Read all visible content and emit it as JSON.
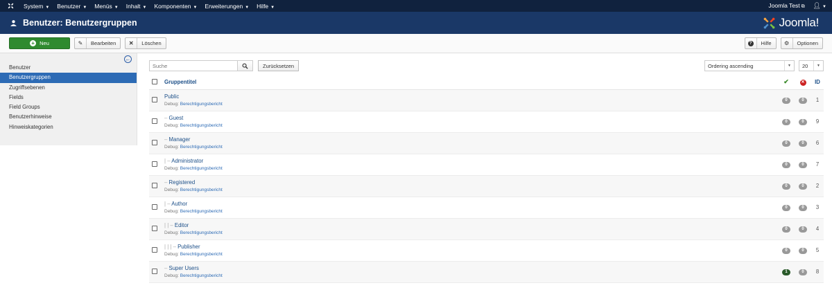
{
  "navbar": {
    "menu": [
      "System",
      "Benutzer",
      "Menüs",
      "Inhalt",
      "Komponenten",
      "Erweiterungen",
      "Hilfe"
    ],
    "site_link": "Joomla Test"
  },
  "header": {
    "title": "Benutzer: Benutzergruppen",
    "brand": "Joomla!"
  },
  "toolbar": {
    "new_label": "Neu",
    "edit_label": "Bearbeiten",
    "delete_label": "Löschen",
    "help_label": "Hilfe",
    "options_label": "Optionen"
  },
  "sidebar": {
    "items": [
      {
        "label": "Benutzer",
        "active": false
      },
      {
        "label": "Benutzergruppen",
        "active": true
      },
      {
        "label": "Zugriffsebenen",
        "active": false
      },
      {
        "label": "Fields",
        "active": false
      },
      {
        "label": "Field Groups",
        "active": false
      },
      {
        "label": "Benutzerhinweise",
        "active": false
      },
      {
        "label": "Hinweiskategorien",
        "active": false
      }
    ]
  },
  "filters": {
    "search_placeholder": "Suche",
    "reset_label": "Zurücksetzen",
    "ordering": "Ordering ascending",
    "limit": "20"
  },
  "table": {
    "header_title": "Gruppentitel",
    "header_id": "ID",
    "debug_prefix": "Debug:",
    "debug_link": "Berechtigungsbericht",
    "rows": [
      {
        "indent": "",
        "name": "Public",
        "active": "0",
        "blocked": "0",
        "id": "1",
        "active_green": false
      },
      {
        "indent": "– ",
        "name": "Guest",
        "active": "0",
        "blocked": "0",
        "id": "9",
        "active_green": false
      },
      {
        "indent": "– ",
        "name": "Manager",
        "active": "0",
        "blocked": "0",
        "id": "6",
        "active_green": false
      },
      {
        "indent": "|  – ",
        "name": "Administrator",
        "active": "0",
        "blocked": "0",
        "id": "7",
        "active_green": false
      },
      {
        "indent": "– ",
        "name": "Registered",
        "active": "0",
        "blocked": "0",
        "id": "2",
        "active_green": false
      },
      {
        "indent": "|  – ",
        "name": "Author",
        "active": "0",
        "blocked": "0",
        "id": "3",
        "active_green": false
      },
      {
        "indent": "|  |  – ",
        "name": "Editor",
        "active": "0",
        "blocked": "0",
        "id": "4",
        "active_green": false
      },
      {
        "indent": "|  |  |  – ",
        "name": "Publisher",
        "active": "0",
        "blocked": "0",
        "id": "5",
        "active_green": false
      },
      {
        "indent": "– ",
        "name": "Super Users",
        "active": "1",
        "blocked": "0",
        "id": "8",
        "active_green": true
      }
    ]
  },
  "colors": {
    "navbar": "#10223e",
    "header": "#1a3867",
    "new_button": "#2f8a2f",
    "active_sidebar": "#2d6bb5",
    "link": "#1c4f88"
  }
}
